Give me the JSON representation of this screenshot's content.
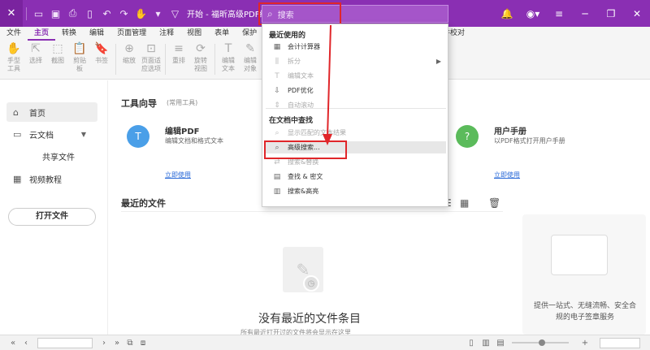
{
  "app": {
    "title": "开始 - 福昕高级PDF编辑器"
  },
  "search": {
    "placeholder": "搜索"
  },
  "ribbon_tabs": [
    "文件",
    "主页",
    "转换",
    "编辑",
    "页面管理",
    "注释",
    "视图",
    "表单",
    "保护"
  ],
  "ribbon_tab_active": "主页",
  "ribbon_extra_tab": "件校对",
  "ribbon_tools": [
    {
      "label": "手型\n工具",
      "icon": "hand-icon"
    },
    {
      "label": "选择",
      "icon": "select-icon"
    },
    {
      "label": "截图",
      "icon": "screenshot-icon"
    },
    {
      "label": "剪贴\n板",
      "icon": "clipboard-icon"
    },
    {
      "label": "书签",
      "icon": "bookmark-icon"
    },
    {
      "label": "缩放",
      "icon": "zoom-icon"
    },
    {
      "label": "页面适\n应选项",
      "icon": "fit-page-icon"
    },
    {
      "label": "重排",
      "icon": "reflow-icon"
    },
    {
      "label": "旋转\n视图",
      "icon": "rotate-icon"
    },
    {
      "label": "编辑\n文本",
      "icon": "edit-text-icon"
    },
    {
      "label": "编辑\n对象",
      "icon": "edit-object-icon"
    }
  ],
  "nav": {
    "items": [
      {
        "label": "首页",
        "icon": "home-icon"
      },
      {
        "label": "云文档",
        "icon": "cloud-doc-icon"
      },
      {
        "label": "共享文件",
        "icon": ""
      },
      {
        "label": "视频教程",
        "icon": "video-icon"
      }
    ],
    "open_file": "打开文件"
  },
  "tools_guide": {
    "title": "工具向导",
    "subtitle": "(常用工具)",
    "cards": [
      {
        "title": "编辑PDF",
        "desc": "编辑文档和格式文本",
        "link": "立即使用",
        "color": "#4a9fe8"
      },
      {
        "title": "用户手册",
        "desc": "以PDF格式打开用户手册",
        "link": "立即使用",
        "color": "#5bbb5b"
      }
    ]
  },
  "recent": {
    "title": "最近的文件",
    "empty_title": "没有最近的文件条目",
    "empty_desc": "所有最近打开过的文件将会显示在这里"
  },
  "promo": {
    "text": "提供一站式、无缝流畅、安全合规的电子签章服务"
  },
  "dropdown": {
    "section_recent": "最近使用的",
    "section_in_doc": "在文档中查找",
    "recent_items": [
      {
        "label": "会计计算器",
        "disabled": false,
        "icon": "calculator-icon"
      },
      {
        "label": "拆分",
        "disabled": true,
        "icon": "split-icon",
        "has_submenu": true
      },
      {
        "label": "编辑文本",
        "disabled": true,
        "icon": "edit-text-icon"
      },
      {
        "label": "PDF优化",
        "disabled": false,
        "icon": "optimize-icon"
      },
      {
        "label": "自动滚动",
        "disabled": true,
        "icon": "autoscroll-icon"
      }
    ],
    "find_items": [
      {
        "label": "显示匹配的文本结果",
        "disabled": true,
        "icon": "search-icon"
      },
      {
        "label": "高级搜索...",
        "disabled": false,
        "icon": "advanced-search-icon",
        "hover": true
      },
      {
        "label": "搜索&替换",
        "disabled": true,
        "icon": "replace-icon"
      },
      {
        "label": "查找 & 密文",
        "disabled": false,
        "icon": "redact-icon"
      },
      {
        "label": "搜索&高亮",
        "disabled": false,
        "icon": "highlight-icon"
      }
    ]
  },
  "colors": {
    "brand": "#8a2fb3",
    "highlight": "#e0262a",
    "link": "#2a6ad8"
  }
}
